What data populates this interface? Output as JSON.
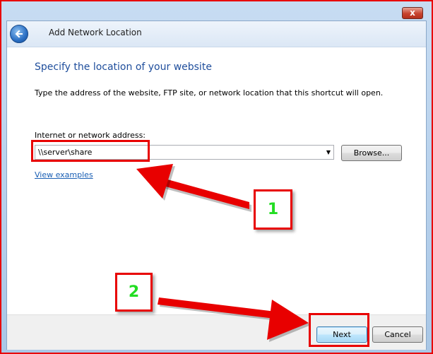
{
  "window": {
    "close_glyph": "x"
  },
  "wizard": {
    "title": "Add Network Location",
    "heading": "Specify the location of your website",
    "instruction": "Type the address of the website, FTP site, or network location that this shortcut will open.",
    "address_label": "Internet or network address:",
    "address_value": "\\\\server\\share",
    "browse_label": "Browse...",
    "examples_link": "View examples",
    "next_label": "Next",
    "cancel_label": "Cancel"
  },
  "annotations": {
    "step1": "1",
    "step2": "2",
    "color": "#e80000",
    "number_color": "#22dd22"
  },
  "icons": {
    "back": "back-arrow-icon",
    "dropdown": "chevron-down-icon",
    "close": "close-icon"
  },
  "colors": {
    "heading": "#1f4e9c",
    "link": "#1a5fb4",
    "chrome": "#b9d1ea"
  }
}
